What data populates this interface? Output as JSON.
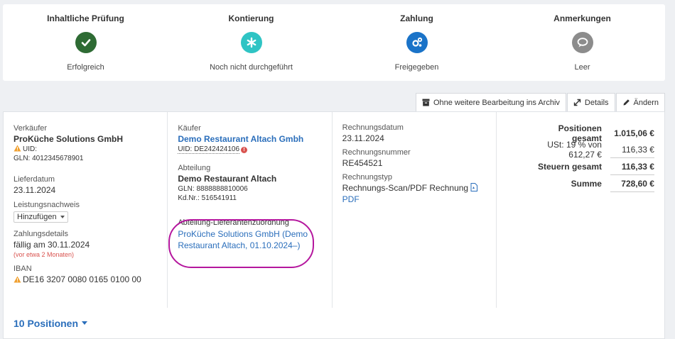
{
  "status_steps": [
    {
      "title": "Inhaltliche Prüfung",
      "status": "Erfolgreich",
      "icon": "check-icon",
      "color": "#2e7d32"
    },
    {
      "title": "Kontierung",
      "status": "Noch nicht durchgeführt",
      "icon": "asterisk-icon",
      "color": "#26c6c6"
    },
    {
      "title": "Zahlung",
      "status": "Freigegeben",
      "icon": "gears-icon",
      "color": "#1976d2"
    },
    {
      "title": "Anmerkungen",
      "status": "Leer",
      "icon": "comment-icon",
      "color": "#8a8a8a"
    }
  ],
  "toolbar": {
    "archive_label": "Ohne weitere Bearbeitung ins Archiv",
    "details_label": "Details",
    "edit_label": "Ändern"
  },
  "seller": {
    "label": "Verkäufer",
    "name": "ProKüche Solutions GmbH",
    "uid_label": "UID:",
    "gln": "GLN: 4012345678901"
  },
  "delivery": {
    "label": "Lieferdatum",
    "date": "23.11.2024"
  },
  "proof": {
    "label": "Leistungsnachweis",
    "value": "Hinzufügen"
  },
  "payment": {
    "label": "Zahlungsdetails",
    "due": "fällig am 30.11.2024",
    "relative": "(vor etwa 2 Monaten)"
  },
  "iban": {
    "label": "IBAN",
    "value": "DE16 3207 0080 0165 0100 00"
  },
  "buyer": {
    "label": "Käufer",
    "name": "Demo Restaurant Altach Gmbh",
    "uid": "UID: DE242424106"
  },
  "department": {
    "label": "Abteilung",
    "name": "Demo Restaurant Altach",
    "gln": "GLN: 8888888810006",
    "kdnr": "Kd.Nr.: 516541911"
  },
  "mapping": {
    "label": "Abteilung-Lieferantenzuordnung",
    "value": "ProKüche Solutions GmbH (Demo Restaurant Altach, 01.10.2024–)"
  },
  "invoice": {
    "date_label": "Rechnungsdatum",
    "date": "23.11.2024",
    "number_label": "Rechnungsnummer",
    "number": "RE454521",
    "type_label": "Rechnungstyp",
    "type": "Rechnungs-Scan/PDF Rechnung",
    "pdf_link": "PDF"
  },
  "totals": {
    "positions_label": "Positionen gesamt",
    "positions_value": "1.015,06 €",
    "vat_label": "USt: 19 % von 612,27 €",
    "vat_value": "116,33 €",
    "tax_label": "Steuern gesamt",
    "tax_value": "116,33 €",
    "sum_label": "Summe",
    "sum_value": "728,60 €"
  },
  "footer": {
    "positions_label": "10 Positionen"
  }
}
